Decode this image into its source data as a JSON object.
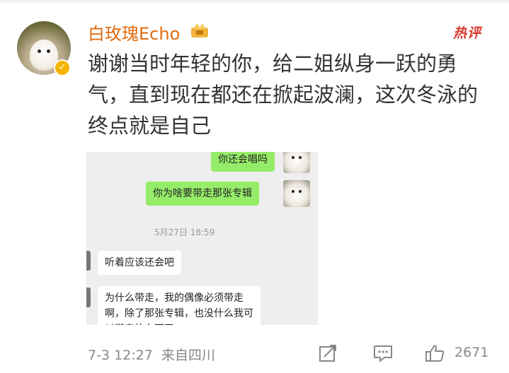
{
  "post": {
    "username": "白玫瑰Echo",
    "hot_label": "热评",
    "content": "谢谢当时年轻的你，给二姐纵身一跃的勇气，直到现在都还在掀起波澜，这次冬泳的终点就是自己",
    "date": "7-3 12:27",
    "source": "来自四川",
    "like_count": "2671"
  },
  "chat_screenshot": {
    "messages": [
      {
        "side": "right",
        "text": "你还会唱吗"
      },
      {
        "side": "right",
        "text": "你为啥要带走那张专辑"
      },
      {
        "side": "left",
        "text": "听着应该还会吧"
      },
      {
        "side": "left",
        "text": "为什么带走，我的偶像必须带走啊，除了那张专辑，也没什么我可以带走的东西了"
      }
    ],
    "timestamp": "5月27日 18:59"
  },
  "icons": {
    "verified": "verified-badge-icon",
    "vip": "crown-badge-icon",
    "share": "share-icon",
    "comment": "comment-icon",
    "like": "thumbs-up-icon"
  },
  "colors": {
    "username": "#e06a0c",
    "hot": "#d8392f",
    "chat_green": "#95ec69"
  }
}
